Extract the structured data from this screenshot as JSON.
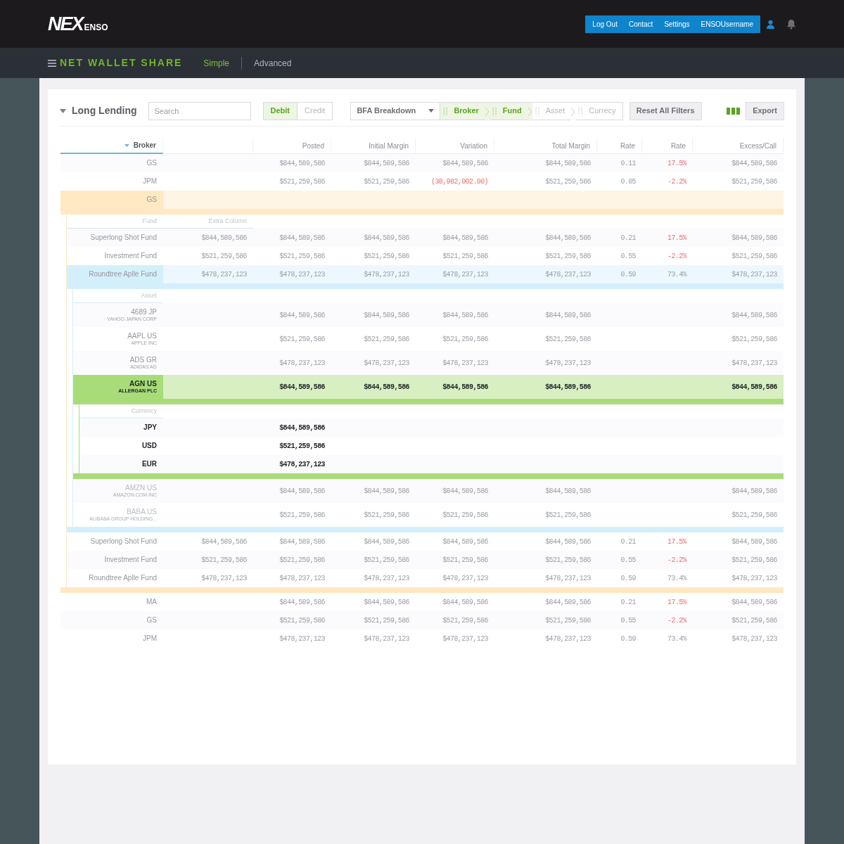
{
  "header": {
    "logo": {
      "mark": "NEX",
      "text": "ENSO"
    },
    "nav": [
      "Log Out",
      "Contact",
      "Settings",
      "ENSOUsername"
    ]
  },
  "subnav": {
    "title": "NET WALLET SHARE",
    "tabs": [
      {
        "label": "Simple",
        "selected": true
      },
      {
        "label": "Advanced",
        "selected": false
      }
    ]
  },
  "toolbar": {
    "title": "Long Lending",
    "search": {
      "placeholder": "Search"
    },
    "mode_toggle": [
      {
        "label": "Debit",
        "selected": true
      },
      {
        "label": "Credit",
        "selected": false
      }
    ],
    "breakdown": {
      "value": "BFA Breakdown"
    },
    "breadcrumb": [
      {
        "label": "Broker",
        "active": true
      },
      {
        "label": "Fund",
        "active": true
      },
      {
        "label": "Asset",
        "active": false
      },
      {
        "label": "Currecy",
        "active": false
      }
    ],
    "reset_button": "Reset All Filters",
    "export_button": "Export"
  },
  "table": {
    "columns": [
      {
        "label": "Broker",
        "sorted": true
      },
      {
        "sorted": false
      },
      {
        "label": "Posted",
        "sorted": false
      },
      {
        "label": "Initial Margin",
        "sorted": false
      },
      {
        "label": "Variation",
        "sorted": false
      },
      {
        "label": "Total Margin",
        "sorted": false
      },
      {
        "label": "Rate",
        "sorted": false
      },
      {
        "label": "Rate",
        "sorted": false
      },
      {
        "label": "Excess/Call",
        "sorted": false
      }
    ],
    "rows": [
      {
        "expanded": false,
        "cells": [
          "GS",
          "",
          "$844,589,586",
          "$844,589,586",
          "$844,589,586",
          "$844,589,586",
          "0.11",
          {
            "text": "17.5%",
            "alert": true
          },
          "$844,589,586"
        ]
      },
      {
        "expanded": false,
        "cells": [
          "JPM",
          "",
          "$521,259,586",
          "$521,259,586",
          {
            "text": "(38,982,002.00)",
            "alert": true
          },
          "$521,259,586",
          "0.05",
          {
            "text": "-2.2%",
            "alert": true
          },
          "$521,259,586"
        ]
      },
      {
        "expanded": true,
        "color": "#ffe8c2",
        "cells": [
          "GS",
          "",
          "",
          "",
          "",
          "",
          "",
          "",
          ""
        ],
        "children": {
          "columns": [
            "Fund",
            "Extra Column"
          ],
          "rows": [
            {
              "expanded": false,
              "cells": [
                "Superlong Shot Fund",
                "$844,589,586",
                "$844,589,586",
                "$844,589,586",
                "$844,589,586",
                "$844,589,586",
                "0.21",
                {
                  "text": "17.5%",
                  "alert": true
                },
                "$844,589,586"
              ]
            },
            {
              "expanded": false,
              "cells": [
                "Investment Fund",
                "$521,259,586",
                "$521,259,586",
                "$521,259,586",
                "$521,259,586",
                "$521,259,586",
                "0.55",
                {
                  "text": "-2.2%",
                  "alert": true
                },
                "$521,259,586"
              ]
            },
            {
              "expanded": true,
              "color": "#d4effc",
              "cells": [
                "Roundtree Aplle Fund",
                "$478,237,123",
                "$478,237,123",
                "$478,237,123",
                "$478,237,123",
                "$478,237,123",
                "0.59",
                "73.4%",
                "$478,237,123"
              ],
              "children": {
                "columns": [
                  "Asset"
                ],
                "rows": [
                  {
                    "sublabel": "YAHOO JAPAN CORP",
                    "expanded": false,
                    "selected": false,
                    "dimmed": false,
                    "cells": [
                      "4689 JP",
                      "",
                      "$844,589,586",
                      "$844,589,586",
                      "$844,589,586",
                      "$844,589,586",
                      "",
                      "",
                      "$844,589,586"
                    ]
                  },
                  {
                    "sublabel": "APPLE INC",
                    "expanded": false,
                    "selected": false,
                    "dimmed": false,
                    "cells": [
                      "AAPL US",
                      "",
                      "$521,259,586",
                      "$521,259,586",
                      "$521,259,586",
                      "$521,259,586",
                      "",
                      "",
                      "$521,259,586"
                    ]
                  },
                  {
                    "sublabel": "ADIDAS AG",
                    "expanded": false,
                    "selected": false,
                    "dimmed": false,
                    "cells": [
                      "ADS GR",
                      "",
                      "$478,237,123",
                      "$478,237,123",
                      "$478,237,123",
                      "$478,237,123",
                      "",
                      "",
                      "$478,237,123"
                    ]
                  },
                  {
                    "sublabel": "ALLERGAN PLC",
                    "expanded": true,
                    "selected": true,
                    "dimmed": false,
                    "color": "#a8dc78",
                    "cells": [
                      "AGN US",
                      "",
                      "$844,589,586",
                      "$844,589,586",
                      "$844,589,586",
                      "$844,589,586",
                      "",
                      "",
                      "$844,589,586"
                    ],
                    "children": {
                      "columns": [
                        "Currency"
                      ],
                      "rows": [
                        {
                          "expanded": false,
                          "cells": [
                            "JPY",
                            "",
                            "$844,589,586",
                            "",
                            "",
                            "",
                            "",
                            "",
                            ""
                          ]
                        },
                        {
                          "expanded": false,
                          "cells": [
                            "USD",
                            "",
                            "$521,259,586",
                            "",
                            "",
                            "",
                            "",
                            "",
                            ""
                          ]
                        },
                        {
                          "expanded": false,
                          "cells": [
                            "EUR",
                            "",
                            "$478,237,123",
                            "",
                            "",
                            "",
                            "",
                            "",
                            ""
                          ]
                        }
                      ]
                    }
                  },
                  {
                    "sublabel": "AMAZON.COM INC",
                    "expanded": false,
                    "selected": false,
                    "dimmed": true,
                    "cells": [
                      "AMZN US",
                      "",
                      "$844,589,586",
                      "$844,589,586",
                      "$844,589,586",
                      "$844,589,586",
                      "",
                      "",
                      "$844,589,586"
                    ]
                  },
                  {
                    "sublabel": "ALIBABA GROUP HOLDING...",
                    "expanded": false,
                    "selected": false,
                    "dimmed": true,
                    "cells": [
                      "BABA US",
                      "",
                      "$521,259,586",
                      "$521,259,586",
                      "$521,259,586",
                      "$521,259,586",
                      "",
                      "",
                      "$521,259,586"
                    ]
                  }
                ]
              }
            },
            {
              "expanded": false,
              "cells": [
                "Superlong Shot Fund",
                "$844,589,586",
                "$844,589,586",
                "$844,589,586",
                "$844,589,586",
                "$844,589,586",
                "0.21",
                {
                  "text": "17.5%",
                  "alert": true
                },
                "$844,589,586"
              ]
            },
            {
              "expanded": false,
              "cells": [
                "Investment Fund",
                "$521,259,586",
                "$521,259,586",
                "$521,259,586",
                "$521,259,586",
                "$521,259,586",
                "0.55",
                {
                  "text": "-2.2%",
                  "alert": true
                },
                "$521,259,586"
              ]
            },
            {
              "expanded": false,
              "cells": [
                "Roundtree Aplle Fund",
                "$478,237,123",
                "$478,237,123",
                "$478,237,123",
                "$478,237,123",
                "$478,237,123",
                "0.59",
                "73.4%",
                "$478,237,123"
              ]
            }
          ]
        }
      },
      {
        "expanded": false,
        "cells": [
          "MA",
          "",
          "$844,589,586",
          "$844,589,586",
          "$844,589,586",
          "$844,589,586",
          "0.21",
          {
            "text": "17.5%",
            "alert": true
          },
          "$844,589,586"
        ]
      },
      {
        "expanded": false,
        "cells": [
          "GS",
          "",
          "$521,259,586",
          "$521,259,586",
          "$521,259,586",
          "$521,259,586",
          "0.55",
          {
            "text": "-2.2%",
            "alert": true
          },
          "$521,259,586"
        ]
      },
      {
        "expanded": false,
        "cells": [
          "JPM",
          "",
          "$478,237,123",
          "$478,237,123",
          "$478,237,123",
          "$478,237,123",
          "0.59",
          "73.4%",
          "$478,237,123"
        ]
      }
    ]
  }
}
